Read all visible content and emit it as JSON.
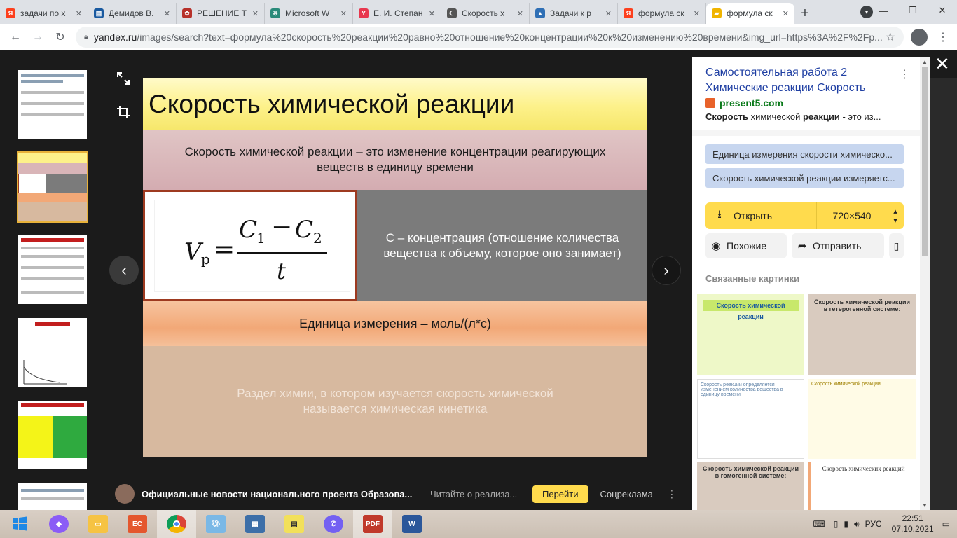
{
  "tabs": [
    {
      "title": "задачи по х",
      "color": "#fc3f1d",
      "glyph": "Я"
    },
    {
      "title": "Демидов В.",
      "color": "#1a5aa0",
      "glyph": "▤"
    },
    {
      "title": "РЕШЕНИЕ Т",
      "color": "#b7312a",
      "glyph": "✿"
    },
    {
      "title": "Microsoft W",
      "color": "#2a8a7a",
      "glyph": "※"
    },
    {
      "title": "Е. И. Степан",
      "color": "#e8384f",
      "glyph": "Y"
    },
    {
      "title": "Скорость х",
      "color": "#555555",
      "glyph": "☾"
    },
    {
      "title": "Задачи к р",
      "color": "#2f6fb5",
      "glyph": "▲"
    },
    {
      "title": "формула ск",
      "color": "#fc3f1d",
      "glyph": "Я"
    },
    {
      "title": "формула ск",
      "color": "#f0b400",
      "glyph": "▰",
      "active": true
    }
  ],
  "address_bar": {
    "domain": "yandex.ru",
    "path": "/images/search?text=формула%20скорость%20реакции%20равно%20отношение%20концентрации%20к%20изменению%20времени&img_url=https%3A%2F%2Fp..."
  },
  "slide": {
    "title": "Скорость химической реакции",
    "definition": "Скорость химической реакции – это изменение концентрации реагирующих веществ в единицу времени",
    "concentration": "С – концентрация (отношение количества вещества к объему, которое оно занимает)",
    "units": "Единица измерения – моль/(л*с)",
    "kinetics": "Раздел химии, в котором изучается скорость химической называется химическая кинетика",
    "formula": {
      "lhs": "V",
      "lhs_sub": "р",
      "num_a": "C",
      "num_a_sub": "1",
      "minus": "−",
      "num_b": "C",
      "num_b_sub": "2",
      "den": "t",
      "eq": "="
    }
  },
  "news": {
    "title": "Официальные новости национального проекта Образова...",
    "subtitle": "Читайте о реализа...",
    "button": "Перейти",
    "ads": "Соцреклама"
  },
  "panel": {
    "title": "Самостоятельная работа 2 Химические реакции Скорость",
    "source": "present5.com",
    "snippet_bold1": "Скорость",
    "snippet_mid": " химической ",
    "snippet_bold2": "реакции",
    "snippet_tail": " - это из...",
    "chips": [
      "Единица измерения скорости химическо...",
      "Скорость химической реакции измеряетс..."
    ],
    "open_label": "Открыть",
    "size_label": "720×540",
    "similar_label": "Похожие",
    "share_label": "Отправить",
    "related_label": "Связанные картинки",
    "related": [
      {
        "heading": "Скорость химической реакции",
        "bg": "#eef8c8"
      },
      {
        "heading": "Скорость химической реакции в гетерогенной системе:",
        "bg": "#d9cbbf"
      },
      {
        "heading": "Скорость реакции определяется изменением количества вещества в единицу времени",
        "bg": "#ffffff"
      },
      {
        "heading": "Скорость химической реакции",
        "bg": "#fffbe6"
      },
      {
        "heading": "Скорость химической реакции в гомогенной системе:",
        "bg": "#d9cbbf"
      },
      {
        "heading": "Скорость химических реакций",
        "bg": "#ffffff"
      }
    ]
  },
  "taskbar": {
    "lang": "РУС",
    "time": "22:51",
    "date": "07.10.2021"
  }
}
